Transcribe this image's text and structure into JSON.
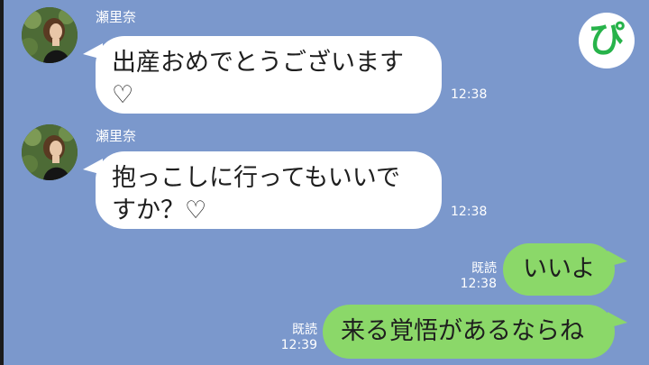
{
  "app": {
    "logo_text": "ぴ",
    "colors": {
      "background": "#7b98cc",
      "incoming_bubble": "#ffffff",
      "outgoing_bubble": "#8bd869",
      "logo": "#27b34a"
    }
  },
  "messages": [
    {
      "direction": "incoming",
      "sender": "瀬里奈",
      "avatar": "avatar-photo",
      "text": "出産おめでとうございます♡",
      "time": "12:38"
    },
    {
      "direction": "incoming",
      "sender": "瀬里奈",
      "avatar": "avatar-photo",
      "text": "抱っこしに行ってもいいですか？♡",
      "time": "12:38"
    },
    {
      "direction": "outgoing",
      "read_label": "既読",
      "text": "いいよ",
      "time": "12:38"
    },
    {
      "direction": "outgoing",
      "read_label": "既読",
      "text": "来る覚悟があるならね",
      "time": "12:39"
    }
  ]
}
